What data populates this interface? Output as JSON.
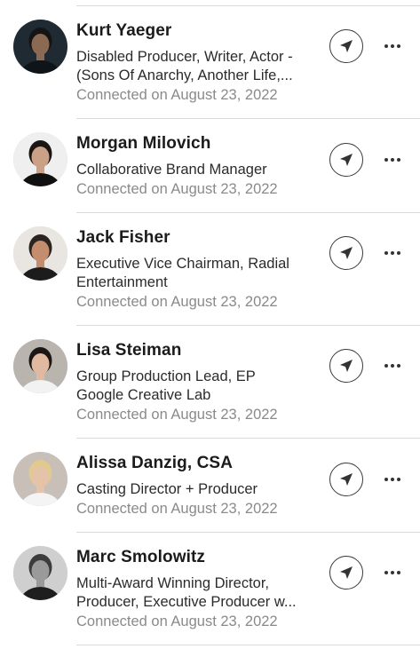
{
  "connections": [
    {
      "name": "Kurt Yaeger",
      "headline_lines": [
        "Disabled Producer, Writer, Actor -",
        "(Sons Of Anarchy, Another Life,..."
      ],
      "connected": "Connected on August 23, 2022",
      "avatar_colors": {
        "bg": "#1f2a33",
        "skin": "#8a6a52",
        "hair": "#141414",
        "shirt": "#0f1418"
      }
    },
    {
      "name": "Morgan Milovich",
      "headline_lines": [
        "Collaborative Brand Manager"
      ],
      "connected": "Connected on August 23, 2022",
      "avatar_colors": {
        "bg": "#efefef",
        "skin": "#caa186",
        "hair": "#1a1412",
        "shirt": "#101010"
      }
    },
    {
      "name": "Jack Fisher",
      "headline_lines": [
        "Executive Vice Chairman, Radial",
        "Entertainment"
      ],
      "connected": "Connected on August 23, 2022",
      "avatar_colors": {
        "bg": "#e9e6e2",
        "skin": "#c48d6e",
        "hair": "#2b2320",
        "shirt": "#1c1c1c"
      }
    },
    {
      "name": "Lisa Steiman",
      "headline_lines": [
        "Group Production Lead, EP",
        "Google Creative Lab"
      ],
      "connected": "Connected on August 23, 2022",
      "avatar_colors": {
        "bg": "#b9b4ad",
        "skin": "#e0b9a0",
        "hair": "#1c1714",
        "shirt": "#f2f2f2"
      }
    },
    {
      "name": "Alissa Danzig, CSA",
      "headline_lines": [
        "Casting Director + Producer"
      ],
      "connected": "Connected on August 23, 2022",
      "avatar_colors": {
        "bg": "#c8c0b8",
        "skin": "#e4c3a8",
        "hair": "#e2c98e",
        "shirt": "#f4f4f4"
      }
    },
    {
      "name": "Marc Smolowitz",
      "headline_lines": [
        "Multi-Award Winning Director,",
        "Producer, Executive Producer w..."
      ],
      "connected": "Connected on August 23, 2022",
      "avatar_colors": {
        "bg": "#cfcfcf",
        "skin": "#9a9a9a",
        "hair": "#3c3c3c",
        "shirt": "#1e1e1e"
      }
    }
  ],
  "icons": {
    "send": "send-paper-plane-icon",
    "more": "more-horizontal-icon"
  },
  "colors": {
    "name": "#1b1b1b",
    "headline": "#2b2b2b",
    "connected": "#8a8a8a",
    "divider": "#d9d9d9"
  }
}
